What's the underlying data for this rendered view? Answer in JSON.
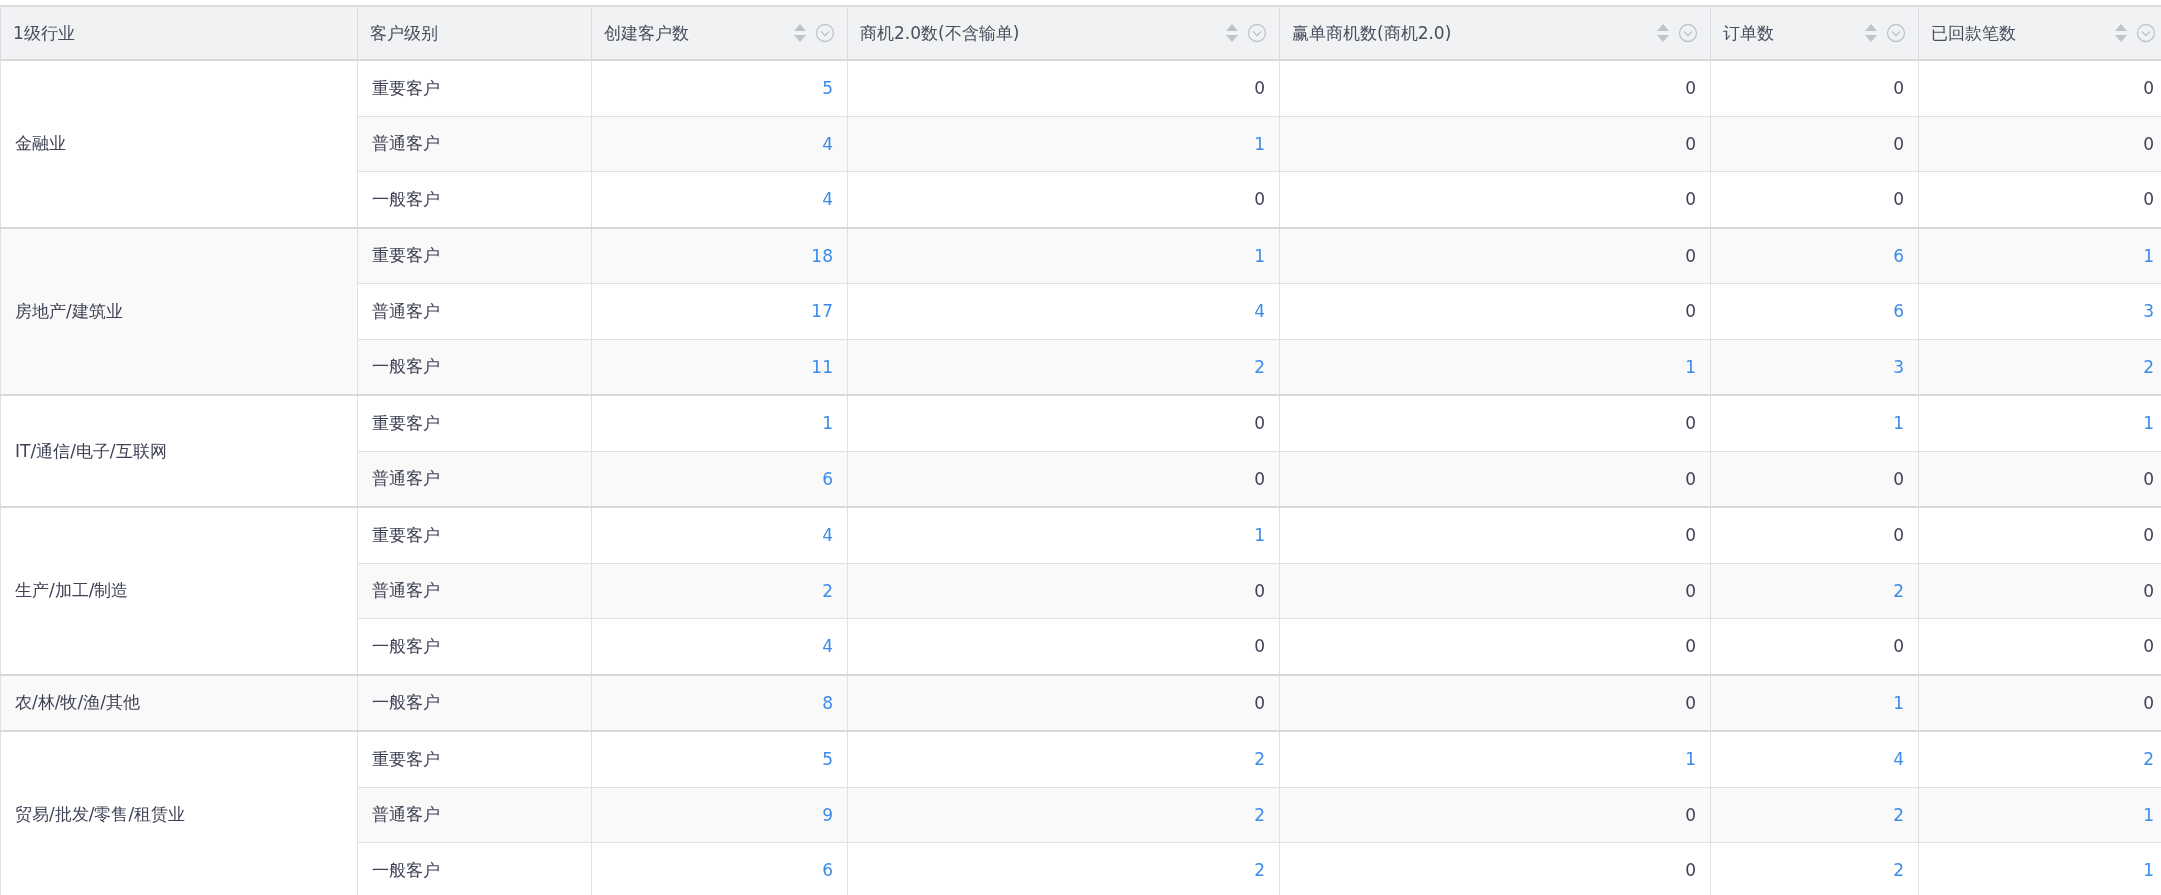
{
  "table": {
    "columns": [
      {
        "label": "1级行业",
        "sortable": false
      },
      {
        "label": "客户级别",
        "sortable": false
      },
      {
        "label": "创建客户数",
        "sortable": true
      },
      {
        "label": "商机2.0数(不含输单)",
        "sortable": true
      },
      {
        "label": "赢单商机数(商机2.0)",
        "sortable": true
      },
      {
        "label": "订单数",
        "sortable": true
      },
      {
        "label": "已回款笔数",
        "sortable": true
      }
    ],
    "groups": [
      {
        "industry": "金融业",
        "rows": [
          {
            "level": "重要客户",
            "cells": [
              {
                "text": "5",
                "link": true
              },
              {
                "text": "0",
                "link": false
              },
              {
                "text": "0",
                "link": false
              },
              {
                "text": "0",
                "link": false
              },
              {
                "text": "0",
                "link": false
              }
            ]
          },
          {
            "level": "普通客户",
            "cells": [
              {
                "text": "4",
                "link": true
              },
              {
                "text": "1",
                "link": true
              },
              {
                "text": "0",
                "link": false
              },
              {
                "text": "0",
                "link": false
              },
              {
                "text": "0",
                "link": false
              }
            ]
          },
          {
            "level": "一般客户",
            "cells": [
              {
                "text": "4",
                "link": true
              },
              {
                "text": "0",
                "link": false
              },
              {
                "text": "0",
                "link": false
              },
              {
                "text": "0",
                "link": false
              },
              {
                "text": "0",
                "link": false
              }
            ]
          }
        ]
      },
      {
        "industry": "房地产/建筑业",
        "rows": [
          {
            "level": "重要客户",
            "cells": [
              {
                "text": "18",
                "link": true
              },
              {
                "text": "1",
                "link": true
              },
              {
                "text": "0",
                "link": false
              },
              {
                "text": "6",
                "link": true
              },
              {
                "text": "1",
                "link": true
              }
            ]
          },
          {
            "level": "普通客户",
            "cells": [
              {
                "text": "17",
                "link": true
              },
              {
                "text": "4",
                "link": true
              },
              {
                "text": "0",
                "link": false
              },
              {
                "text": "6",
                "link": true
              },
              {
                "text": "3",
                "link": true
              }
            ]
          },
          {
            "level": "一般客户",
            "cells": [
              {
                "text": "11",
                "link": true
              },
              {
                "text": "2",
                "link": true
              },
              {
                "text": "1",
                "link": true
              },
              {
                "text": "3",
                "link": true
              },
              {
                "text": "2",
                "link": true
              }
            ]
          }
        ]
      },
      {
        "industry": "IT/通信/电子/互联网",
        "rows": [
          {
            "level": "重要客户",
            "cells": [
              {
                "text": "1",
                "link": true
              },
              {
                "text": "0",
                "link": false
              },
              {
                "text": "0",
                "link": false
              },
              {
                "text": "1",
                "link": true
              },
              {
                "text": "1",
                "link": true
              }
            ]
          },
          {
            "level": "普通客户",
            "cells": [
              {
                "text": "6",
                "link": true
              },
              {
                "text": "0",
                "link": false
              },
              {
                "text": "0",
                "link": false
              },
              {
                "text": "0",
                "link": false
              },
              {
                "text": "0",
                "link": false
              }
            ]
          }
        ]
      },
      {
        "industry": "生产/加工/制造",
        "rows": [
          {
            "level": "重要客户",
            "cells": [
              {
                "text": "4",
                "link": true
              },
              {
                "text": "1",
                "link": true
              },
              {
                "text": "0",
                "link": false
              },
              {
                "text": "0",
                "link": false
              },
              {
                "text": "0",
                "link": false
              }
            ]
          },
          {
            "level": "普通客户",
            "cells": [
              {
                "text": "2",
                "link": true
              },
              {
                "text": "0",
                "link": false
              },
              {
                "text": "0",
                "link": false
              },
              {
                "text": "2",
                "link": true
              },
              {
                "text": "0",
                "link": false
              }
            ]
          },
          {
            "level": "一般客户",
            "cells": [
              {
                "text": "4",
                "link": true
              },
              {
                "text": "0",
                "link": false
              },
              {
                "text": "0",
                "link": false
              },
              {
                "text": "0",
                "link": false
              },
              {
                "text": "0",
                "link": false
              }
            ]
          }
        ]
      },
      {
        "industry": "农/林/牧/渔/其他",
        "rows": [
          {
            "level": "一般客户",
            "cells": [
              {
                "text": "8",
                "link": true
              },
              {
                "text": "0",
                "link": false
              },
              {
                "text": "0",
                "link": false
              },
              {
                "text": "1",
                "link": true
              },
              {
                "text": "0",
                "link": false
              }
            ]
          }
        ]
      },
      {
        "industry": "贸易/批发/零售/租赁业",
        "rows": [
          {
            "level": "重要客户",
            "cells": [
              {
                "text": "5",
                "link": true
              },
              {
                "text": "2",
                "link": true
              },
              {
                "text": "1",
                "link": true
              },
              {
                "text": "4",
                "link": true
              },
              {
                "text": "2",
                "link": true
              }
            ]
          },
          {
            "level": "普通客户",
            "cells": [
              {
                "text": "9",
                "link": true
              },
              {
                "text": "2",
                "link": true
              },
              {
                "text": "0",
                "link": false
              },
              {
                "text": "2",
                "link": true
              },
              {
                "text": "1",
                "link": true
              }
            ]
          },
          {
            "level": "一般客户",
            "cells": [
              {
                "text": "6",
                "link": true
              },
              {
                "text": "2",
                "link": true
              },
              {
                "text": "0",
                "link": false
              },
              {
                "text": "2",
                "link": true
              },
              {
                "text": "1",
                "link": true
              }
            ]
          }
        ]
      }
    ]
  }
}
